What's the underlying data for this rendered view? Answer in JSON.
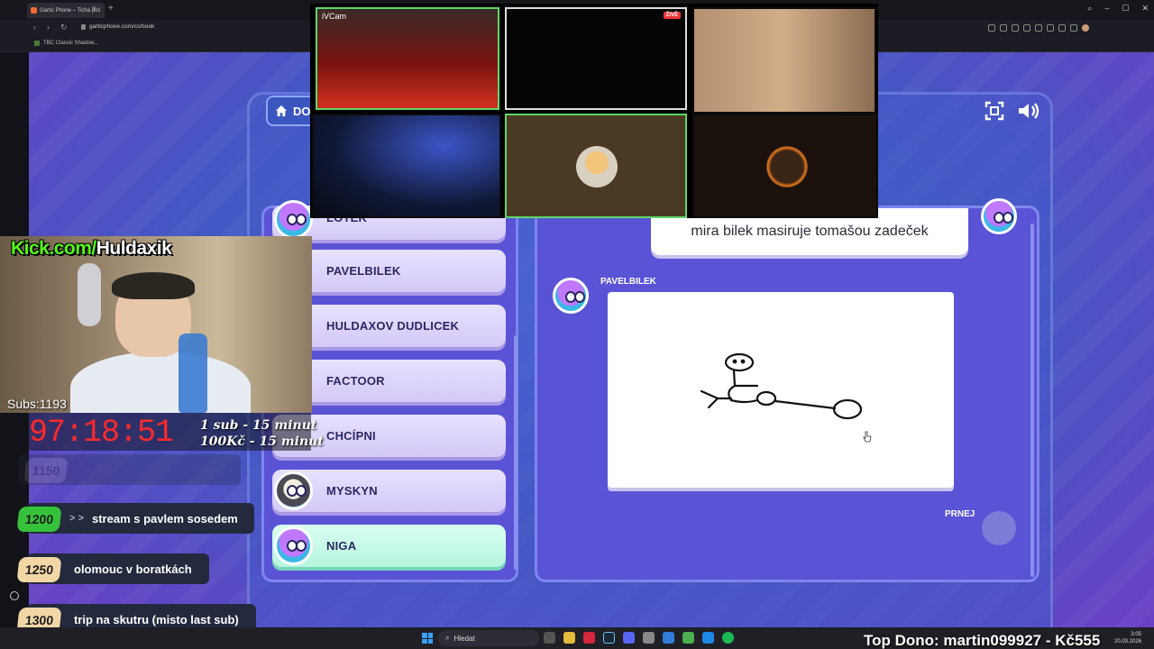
{
  "browser": {
    "tab_title": "Gartic Phone – Tichá poš",
    "url": "garticphone.com/cs/book",
    "bookmark": "TBC Classic Shadow..."
  },
  "game": {
    "home_label": "DO",
    "players": [
      {
        "name": "LOTEK",
        "avatar": "bird"
      },
      {
        "name": "PAVELBILEK",
        "avatar": "none"
      },
      {
        "name": "HULDAXOV DUDLICEK",
        "avatar": "none"
      },
      {
        "name": "FACTOOR",
        "avatar": "none"
      },
      {
        "name": "CHCÍPNI",
        "avatar": "bird"
      },
      {
        "name": "MYSKYN",
        "avatar": "penguin"
      },
      {
        "name": "NIGA",
        "avatar": "bird",
        "active": true
      }
    ],
    "prompt_text": "mira bilek masiruje tomašou zadeček",
    "drawing_author": "PAVELBILEK",
    "next_player": "PRNEJ",
    "accent_color": "#5b53d6"
  },
  "call": {
    "cam1_label": "iVCam",
    "live_label": "ŽIVĚ"
  },
  "stream": {
    "kick_green": "Kick.com/",
    "kick_white": "Huldaxik",
    "subs": "Subs:1193",
    "timer": "97:18:51",
    "rate_line1": "1 sub - 15 minut",
    "rate_line2": "100Kč - 15 minut",
    "goals": [
      {
        "amount": "1150",
        "text": "",
        "color": "#7a7a80",
        "faded": true
      },
      {
        "amount": "1200",
        "text": "stream s pavlem sosedem",
        "color": "#35c23a",
        "arrows": "> >"
      },
      {
        "amount": "1250",
        "text": "olomouc v boratkách",
        "color": "#f1d7a6"
      },
      {
        "amount": "1300",
        "text": "trip na skutru (misto last sub)",
        "color": "#f1d7a6"
      }
    ],
    "top_dono": "Top Dono: martin099927 - Kč555"
  },
  "taskbar": {
    "search_label": "Hledat",
    "time": "3:05",
    "date": "20.03.2026"
  }
}
